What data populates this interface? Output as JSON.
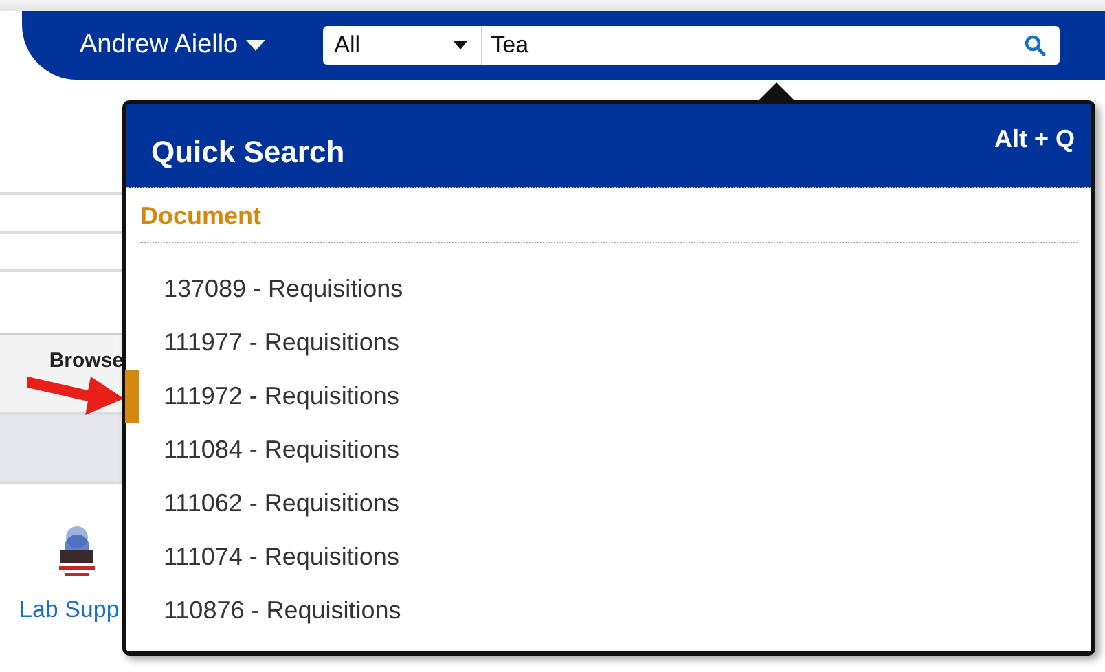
{
  "header": {
    "user_name": "Andrew Aiello",
    "search": {
      "scope": "All",
      "value": "Tea"
    }
  },
  "background": {
    "column_heading": "Browse",
    "link": "Lab Supp"
  },
  "quick_search": {
    "title": "Quick Search",
    "shortcut": "Alt + Q",
    "section": "Document",
    "results": [
      {
        "label": "137089 - Requisitions",
        "selected": false
      },
      {
        "label": "111977 - Requisitions",
        "selected": false
      },
      {
        "label": "111972 - Requisitions",
        "selected": true
      },
      {
        "label": "111084 - Requisitions",
        "selected": false
      },
      {
        "label": "111062 - Requisitions",
        "selected": false
      },
      {
        "label": "111074 - Requisitions",
        "selected": false
      },
      {
        "label": "110876 - Requisitions",
        "selected": false
      }
    ]
  }
}
